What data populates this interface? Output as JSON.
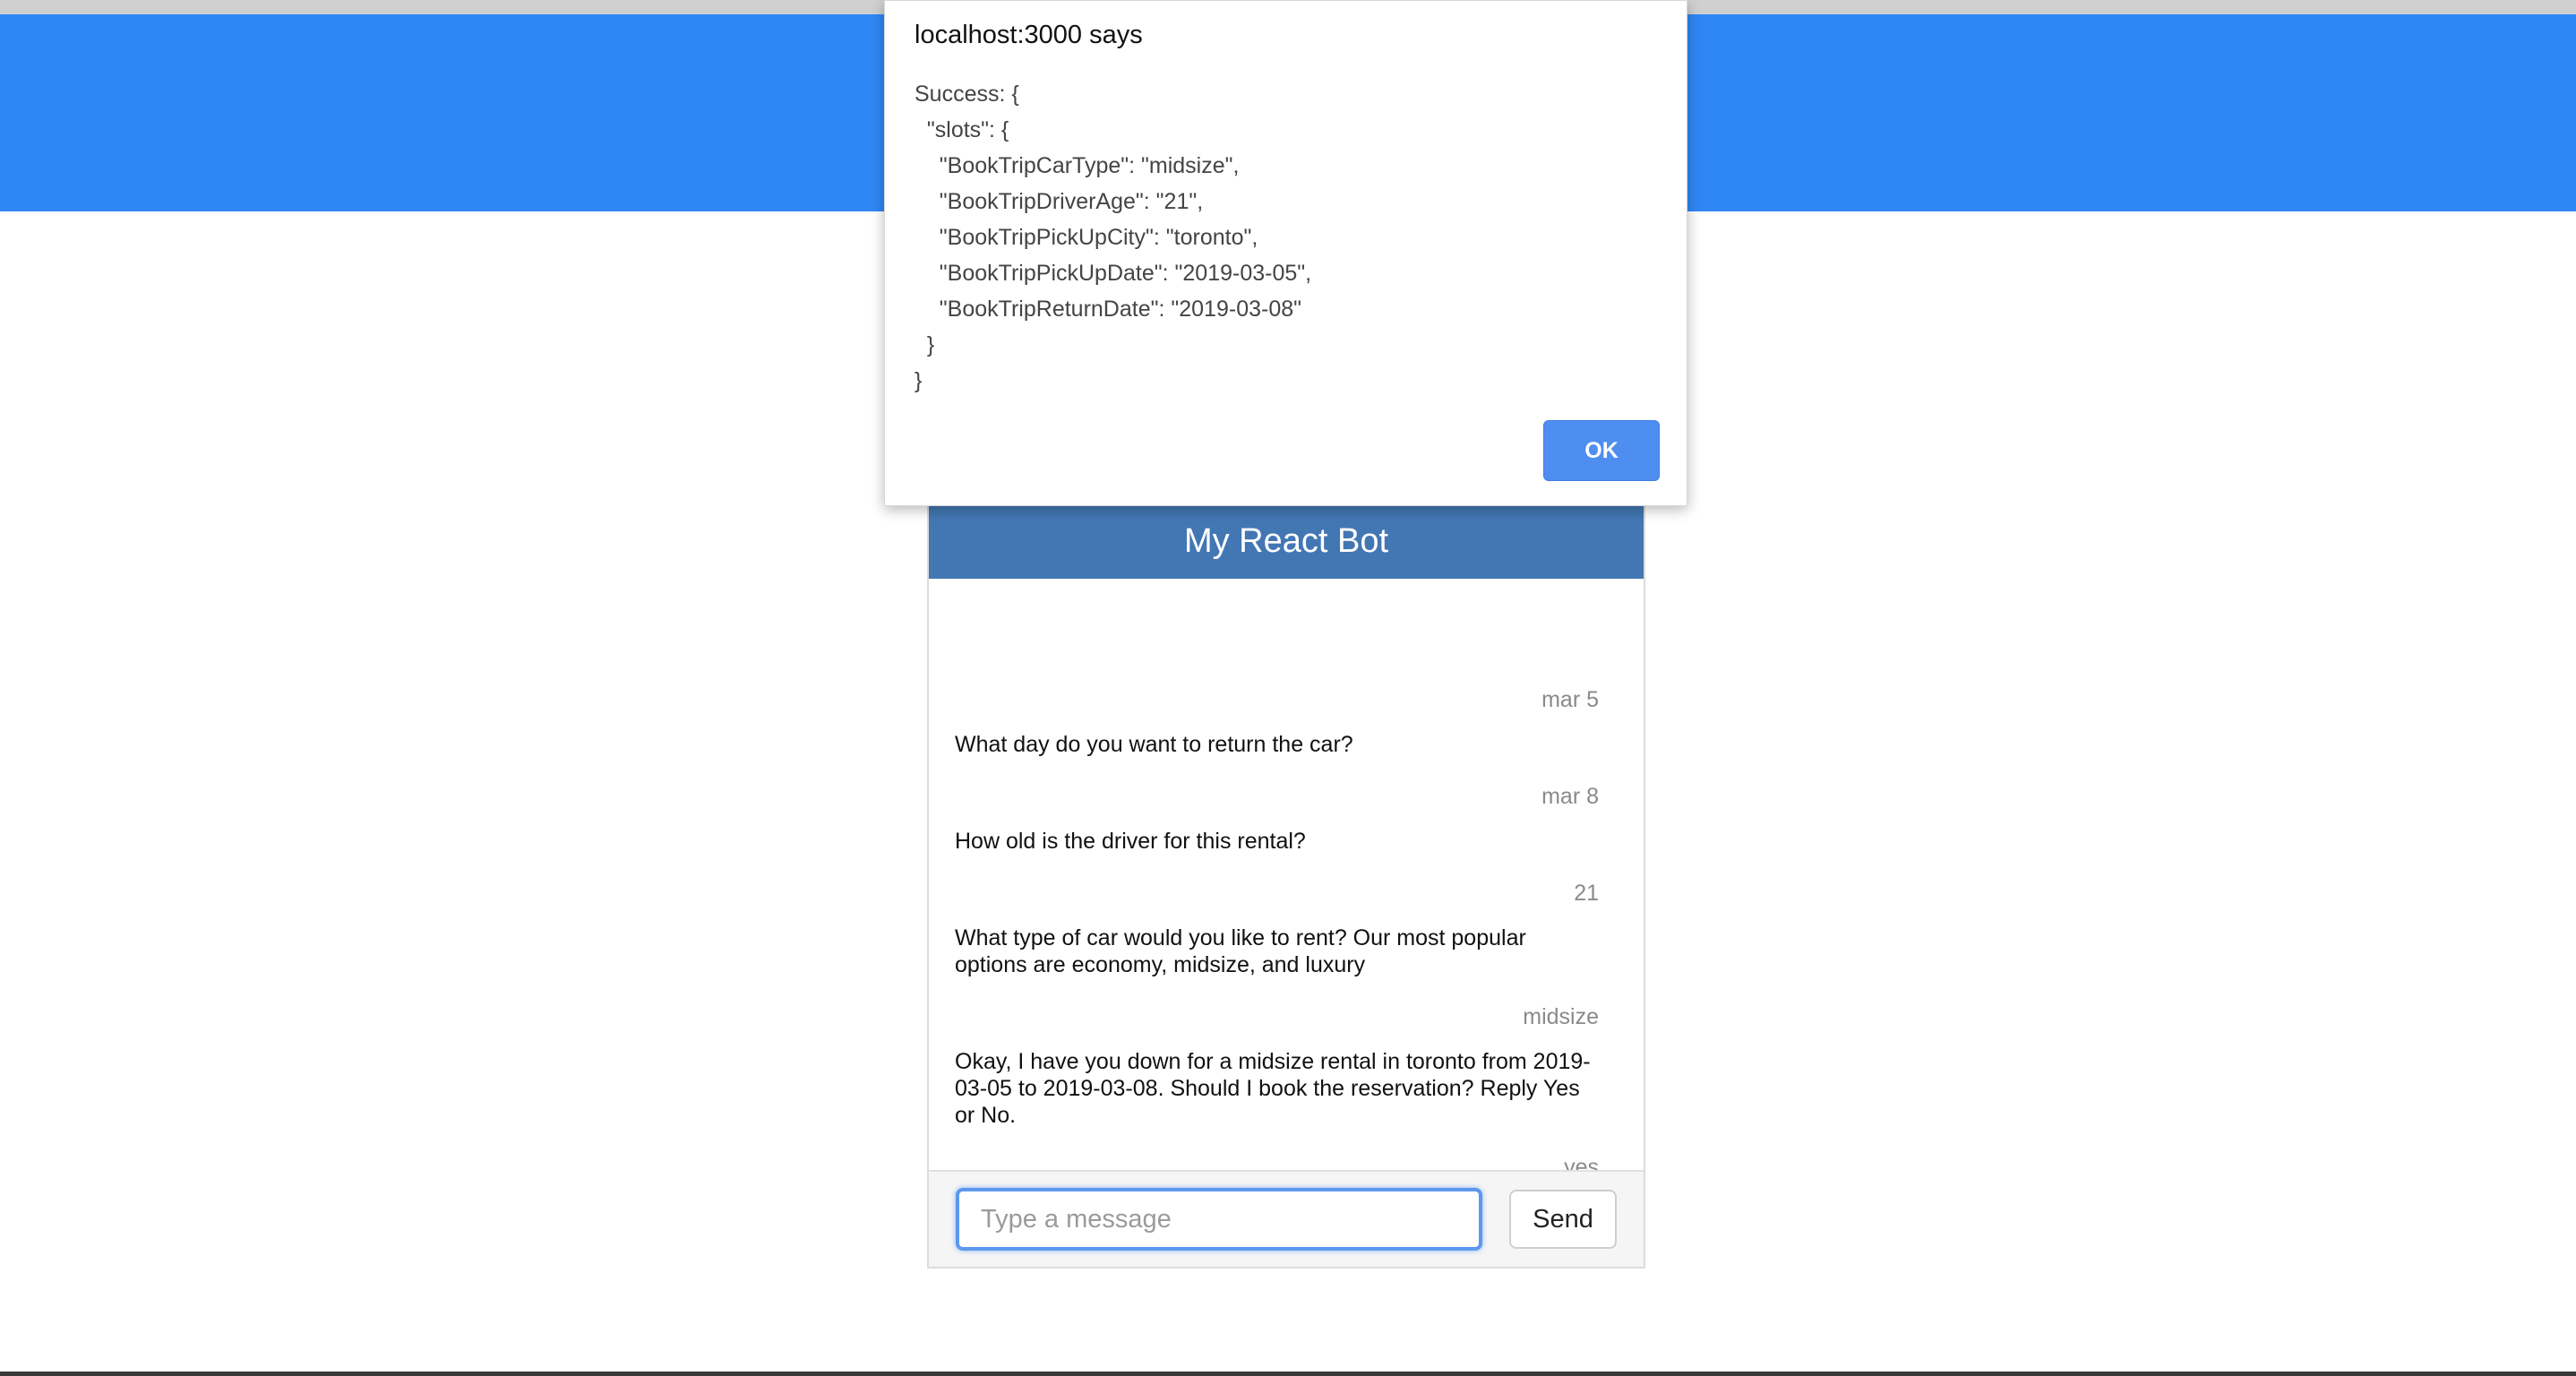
{
  "alert": {
    "title": "localhost:3000 says",
    "message": "Success: {\n  \"slots\": {\n    \"BookTripCarType\": \"midsize\",\n    \"BookTripDriverAge\": \"21\",\n    \"BookTripPickUpCity\": \"toronto\",\n    \"BookTripPickUpDate\": \"2019-03-05\",\n    \"BookTripReturnDate\": \"2019-03-08\"\n  }\n}",
    "ok_label": "OK"
  },
  "chat": {
    "title": "My React Bot",
    "messages": [
      {
        "sender": "user",
        "text": "mar 5"
      },
      {
        "sender": "bot",
        "text": "What day do you want to return the car?"
      },
      {
        "sender": "user",
        "text": "mar 8"
      },
      {
        "sender": "bot",
        "text": "How old is the driver for this rental?"
      },
      {
        "sender": "user",
        "text": "21"
      },
      {
        "sender": "bot",
        "text": "What type of car would you like to rent? Our most popular options are economy, midsize, and luxury"
      },
      {
        "sender": "user",
        "text": "midsize"
      },
      {
        "sender": "bot",
        "text": "Okay, I have you down for a midsize rental in toronto from 2019-03-05 to 2019-03-08. Should I book the reservation? Reply Yes or No."
      },
      {
        "sender": "user",
        "text": "yes"
      }
    ],
    "input": {
      "value": "",
      "placeholder": "Type a message"
    },
    "send_label": "Send"
  },
  "colors": {
    "header": "#2f87f5",
    "chat_title_bar": "#4377b3",
    "ok_button": "#4e8ef0"
  }
}
